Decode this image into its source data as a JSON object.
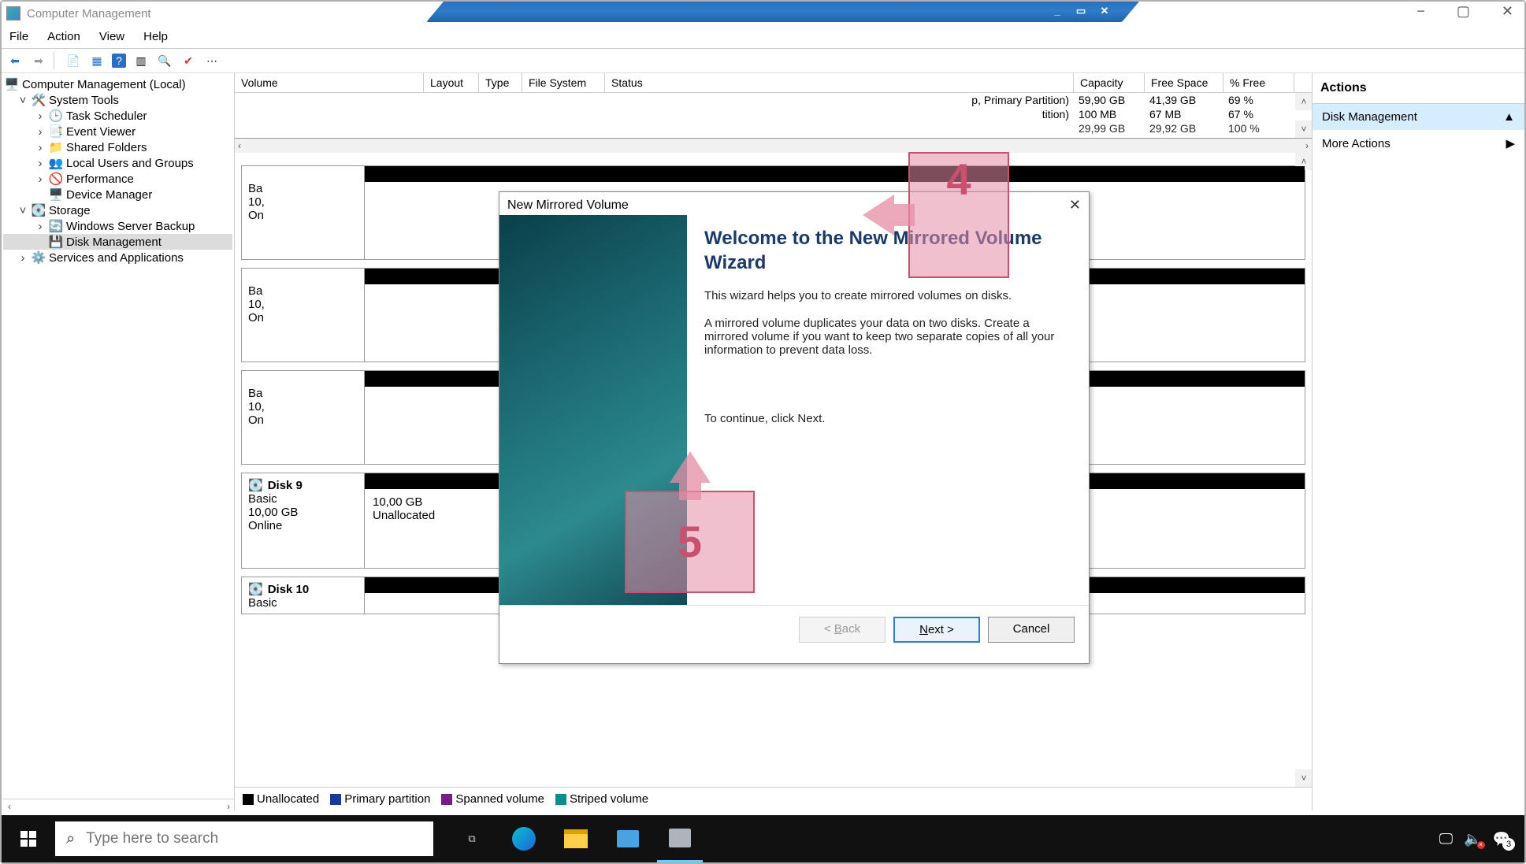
{
  "app": {
    "title": "Computer Management"
  },
  "menu": {
    "file": "File",
    "action": "Action",
    "view": "View",
    "help": "Help"
  },
  "window_controls": {
    "min": "−",
    "max": "▢",
    "close": "✕"
  },
  "tree": {
    "root": "Computer Management (Local)",
    "system_tools": "System Tools",
    "items1": [
      "Task Scheduler",
      "Event Viewer",
      "Shared Folders",
      "Local Users and Groups",
      "Performance",
      "Device Manager"
    ],
    "storage": "Storage",
    "items2": [
      "Windows Server Backup",
      "Disk Management"
    ],
    "services": "Services and Applications"
  },
  "vol_headers": {
    "volume": "Volume",
    "layout": "Layout",
    "type": "Type",
    "fs": "File System",
    "status": "Status",
    "capacity": "Capacity",
    "free": "Free Space",
    "pct": "% Free"
  },
  "vol_rows": [
    {
      "status": "p, Primary Partition)",
      "cap": "59,90 GB",
      "free": "41,39 GB",
      "pct": "69 %"
    },
    {
      "status": "tition)",
      "cap": "100 MB",
      "free": "67 MB",
      "pct": "67 %"
    },
    {
      "status": "",
      "cap": "29,99 GB",
      "free": "29,92 GB",
      "pct": "100 %"
    }
  ],
  "disks": {
    "d9": {
      "name": "Disk 9",
      "type": "Basic",
      "size": "10,00 GB",
      "state": "Online",
      "vol_size": "10,00 GB",
      "vol_label": "Unallocated"
    },
    "d10": {
      "name": "Disk 10",
      "type": "Basic"
    },
    "peek": {
      "type_pref": "Ba",
      "size_pref": "10,",
      "state_pref": "On"
    }
  },
  "legend": {
    "un": "Unallocated",
    "pp": "Primary partition",
    "sp": "Spanned volume",
    "st": "Striped volume"
  },
  "actions": {
    "head": "Actions",
    "dm": "Disk Management",
    "more": "More Actions"
  },
  "wizard": {
    "title": "New Mirrored Volume",
    "heading": "Welcome to the New Mirrored Volume Wizard",
    "p1": "This wizard helps you to create mirrored volumes on disks.",
    "p2": "A mirrored volume duplicates your data on two disks. Create a mirrored volume if you want to keep two separate copies of all your information to prevent data loss.",
    "p3": "To continue, click Next.",
    "back_pre": "< ",
    "back_u": "B",
    "back_post": "ack",
    "next_u": "N",
    "next_post": "ext >",
    "cancel": "Cancel"
  },
  "callouts": {
    "c4": "4",
    "c5": "5"
  },
  "search": {
    "placeholder": "Type here to search"
  },
  "tray": {
    "badge": "3"
  }
}
